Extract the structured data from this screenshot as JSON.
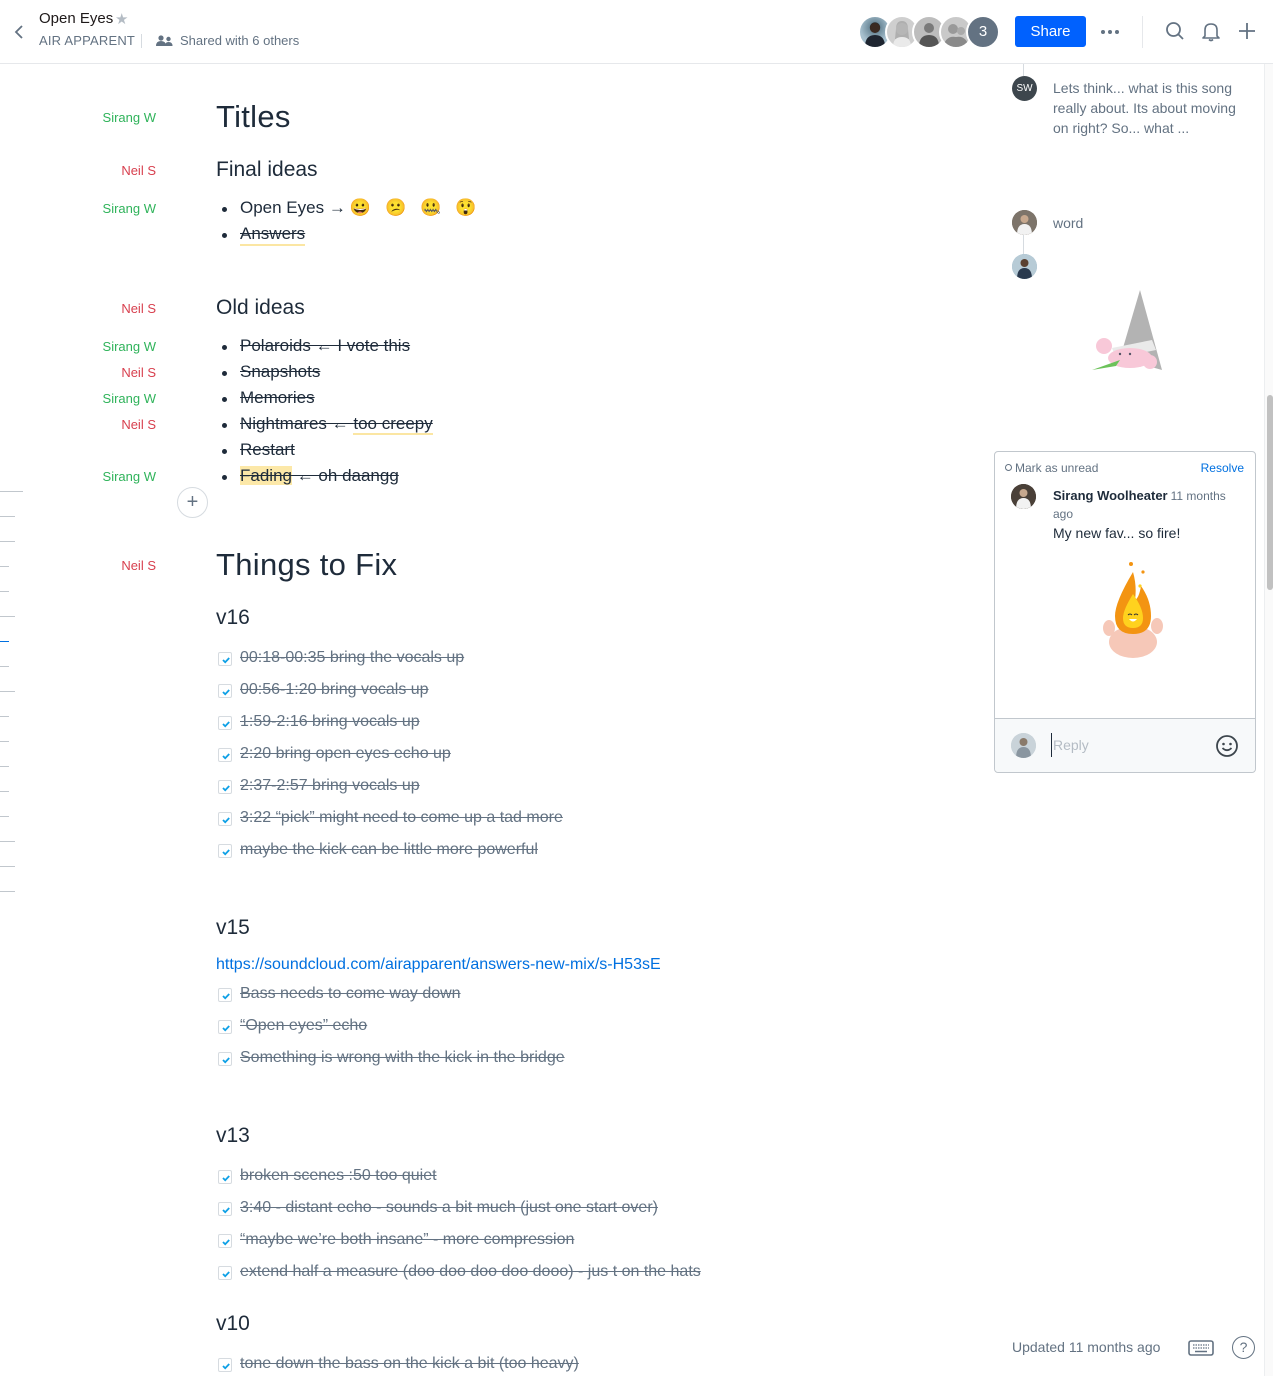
{
  "header": {
    "title": "Open Eyes",
    "folder": "AIR APPARENT",
    "shared": "Shared with 6 others",
    "avatar_overflow": "3",
    "share_label": "Share",
    "more_label": "•••"
  },
  "authors": {
    "titles": "Sirang W",
    "final_ideas": "Neil S",
    "open_eyes": "Sirang W",
    "old_ideas": "Neil S",
    "polaroids": "Sirang W",
    "snapshots": "Neil S",
    "memories": "Sirang W",
    "nightmares": "Neil S",
    "fading": "Sirang W",
    "things_to_fix": "Neil S"
  },
  "doc": {
    "titles_heading": "Titles",
    "final_ideas_heading": "Final ideas",
    "final_ideas": {
      "item1": "Open Eyes →",
      "item1_emojis": [
        "😀",
        "😕",
        "🤐",
        "😲"
      ],
      "item2": "Answers"
    },
    "old_ideas_heading": "Old ideas",
    "old_ideas": {
      "polaroids": "Polaroids ← I vote this",
      "snapshots": "Snapshots",
      "memories": "Memories",
      "nightmares_a": "Nightmares ← ",
      "nightmares_b": "too creepy",
      "restart": "Restart",
      "fading_a": "Fading",
      "fading_b": " ← oh daangg"
    },
    "add_label": "+",
    "things_heading": "Things to Fix",
    "v16": {
      "heading": "v16",
      "items": [
        "00:18-00:35 bring the vocals up",
        "00:56-1:20 bring vocals up",
        "1:59-2:16 bring vocals up",
        "2:20 bring open eyes echo up",
        "2:37-2:57 bring vocals up",
        "3:22 “pick” might need to come up a tad more",
        "maybe the kick can be little more powerful "
      ]
    },
    "v15": {
      "heading": "v15",
      "link": "https://soundcloud.com/airapparent/answers-new-mix/s-H53sE",
      "items": [
        "Bass needs to come way down",
        "“Open eyes” echo",
        "Something is wrong with the kick in the bridge"
      ]
    },
    "v13": {
      "heading": "v13",
      "items": [
        "broken scenes :50 too quiet",
        "3:40 - distant echo - sounds a bit much (just one start over)",
        "“maybe we’re both insane” - more compression",
        "extend half a measure (doo doo doo doo dooo) - jus t on the hats"
      ]
    },
    "v10": {
      "heading": "v10",
      "items": [
        "tone down the bass on the kick a bit (too heavy)"
      ]
    }
  },
  "comments": {
    "thread1": {
      "initials": "SW",
      "text": "Lets think... what is this song really about. Its about moving on right? So... what ..."
    },
    "thread2": {
      "text": "word"
    },
    "card": {
      "mark_unread": "Mark as unread",
      "resolve": "Resolve",
      "author": "Sirang Woolheater",
      "time": "11 months ago",
      "message": "My new fav... so fire!",
      "reply_placeholder": "Reply"
    }
  },
  "footer": {
    "updated": "Updated 11 months ago",
    "help": "?"
  },
  "colors": {
    "accent": "#0061fe",
    "link": "#0070e0",
    "author_green": "#2fb35a",
    "author_red": "#d8404f"
  }
}
